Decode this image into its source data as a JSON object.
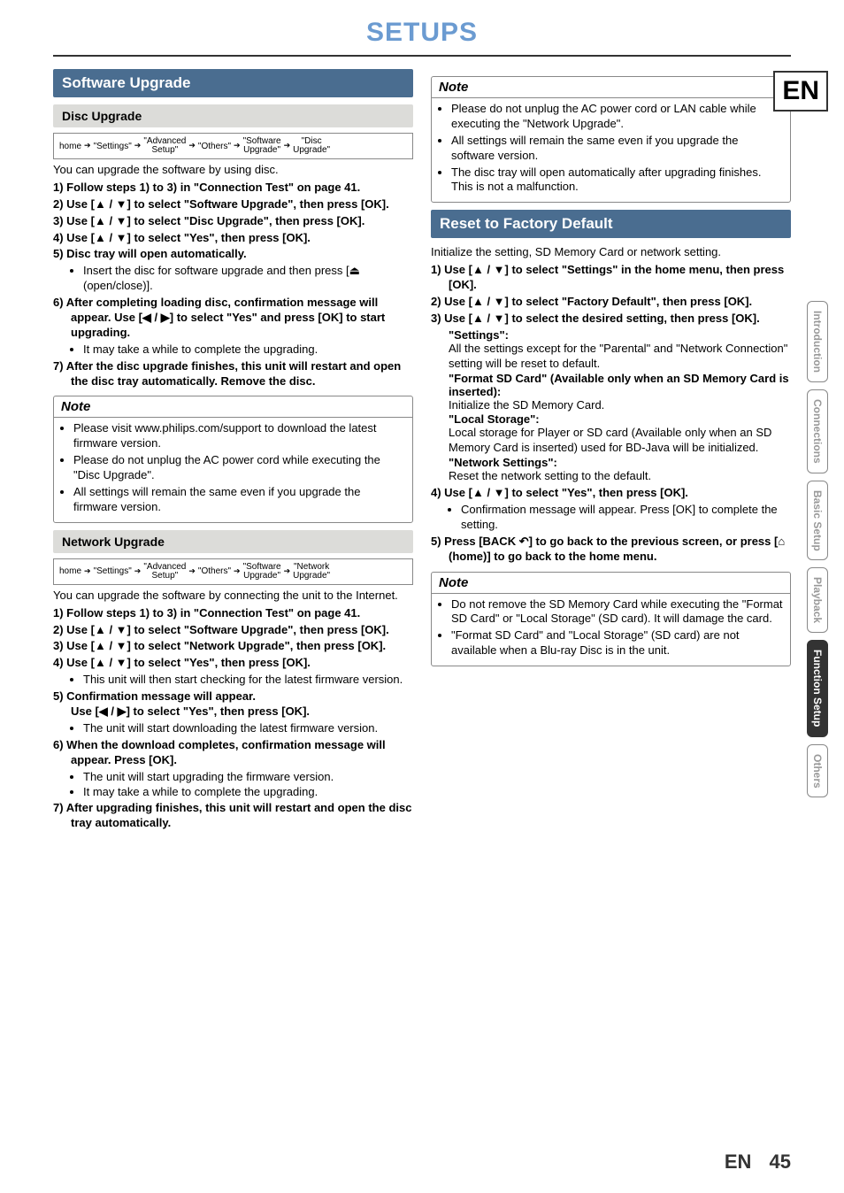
{
  "page_title": "SETUPS",
  "lang_badge": "EN",
  "footer": {
    "lang": "EN",
    "page": "45"
  },
  "tabs": {
    "t1": "Introduction",
    "t2": "Connections",
    "t3": "Basic Setup",
    "t4": "Playback",
    "t5": "Function Setup",
    "t6": "Others"
  },
  "left": {
    "section_title": "Software Upgrade",
    "disc": {
      "title": "Disc Upgrade",
      "crumb": {
        "c1": "home",
        "c2": "\"Settings\"",
        "c3a": "\"Advanced",
        "c3b": "Setup\"",
        "c4": "\"Others\"",
        "c5a": "\"Software",
        "c5b": "Upgrade\"",
        "c6a": "\"Disc",
        "c6b": "Upgrade\""
      },
      "intro": "You can upgrade the software by using disc.",
      "steps": {
        "s1": "1)  Follow steps 1) to 3) in \"Connection Test\" on page 41.",
        "s2": "2)  Use [▲ / ▼] to select \"Software Upgrade\", then press [OK].",
        "s3": "3)  Use [▲ / ▼] to select \"Disc Upgrade\", then press [OK].",
        "s4": "4)  Use [▲ / ▼] to select \"Yes\", then press [OK].",
        "s5": "5)  Disc tray will open automatically.",
        "s5b": "Insert the disc for software upgrade and then press [⏏ (open/close)].",
        "s6": "6)  After completing loading disc, confirmation message will appear. Use [◀ / ▶] to select \"Yes\" and press [OK] to start upgrading.",
        "s6b": "It may take a while to complete the upgrading.",
        "s7": "7)  After the disc upgrade finishes, this unit will restart and open the disc tray automatically. Remove the disc."
      },
      "note_title": "Note",
      "notes": {
        "n1": "Please visit www.philips.com/support to download the latest firmware version.",
        "n2": "Please do not unplug the AC power cord while executing the \"Disc Upgrade\".",
        "n3": "All settings will remain the same even if you upgrade the firmware version."
      }
    },
    "net": {
      "title": "Network Upgrade",
      "crumb": {
        "c1": "home",
        "c2": "\"Settings\"",
        "c3a": "\"Advanced",
        "c3b": "Setup\"",
        "c4": "\"Others\"",
        "c5a": "\"Software",
        "c5b": "Upgrade\"",
        "c6a": "\"Network",
        "c6b": "Upgrade\""
      },
      "intro": "You can upgrade the software by connecting the unit to the Internet.",
      "steps": {
        "s1": "1)  Follow steps 1) to 3) in \"Connection Test\" on page 41.",
        "s2": "2)  Use [▲ / ▼] to select \"Software Upgrade\", then press [OK].",
        "s3": "3)  Use [▲ / ▼] to select \"Network Upgrade\", then press [OK].",
        "s4": "4)  Use [▲ / ▼] to select \"Yes\", then press [OK].",
        "s4b": "This unit will then start checking for the latest firmware version.",
        "s5": "5)  Confirmation message will appear.",
        "s5a": "Use [◀ / ▶] to select \"Yes\", then press [OK].",
        "s5b": "The unit will start downloading the latest firmware version.",
        "s6": "6)  When the download completes, confirmation message will appear. Press [OK].",
        "s6b": "The unit will start upgrading the firmware version.",
        "s6c": "It may take a while to complete the upgrading.",
        "s7": "7)  After upgrading finishes, this unit will restart and open the disc tray automatically."
      }
    }
  },
  "right": {
    "note1": {
      "title": "Note",
      "n1": "Please do not unplug the AC power cord or LAN cable while executing the \"Network Upgrade\".",
      "n2": "All settings will remain the same even if you upgrade the software version.",
      "n3": "The disc tray will open automatically after upgrading finishes. This is not a malfunction."
    },
    "reset": {
      "title": "Reset to Factory Default",
      "intro": "Initialize the setting, SD Memory Card or network setting.",
      "steps": {
        "s1": "1)  Use [▲ / ▼] to select \"Settings\" in the home menu, then press [OK].",
        "s2": "2)  Use [▲ / ▼] to select \"Factory Default\", then press [OK].",
        "s3": "3)  Use [▲ / ▼] to select the desired setting, then press [OK].",
        "s3_h1": "\"Settings\":",
        "s3_t1": "All the settings except for the \"Parental\" and \"Network Connection\" setting will be reset to default.",
        "s3_h2": "\"Format SD Card\" (Available only when an SD Memory Card is inserted):",
        "s3_t2": "Initialize the SD Memory Card.",
        "s3_h3": "\"Local Storage\":",
        "s3_t3": "Local storage for Player or SD card (Available only when an SD Memory Card is inserted) used for BD-Java will be initialized.",
        "s3_h4": "\"Network Settings\":",
        "s3_t4": "Reset the network setting to the default.",
        "s4": "4)  Use [▲ / ▼] to select \"Yes\", then press [OK].",
        "s4b": "Confirmation message will appear. Press [OK] to complete the setting.",
        "s5": "5)  Press [BACK ↶] to go back to the previous screen, or press [⌂ (home)] to go back to the home menu."
      }
    },
    "note2": {
      "title": "Note",
      "n1": "Do not remove the SD Memory Card while executing the \"Format SD Card\" or \"Local Storage\" (SD card). It will damage the card.",
      "n2": "\"Format SD Card\" and \"Local Storage\" (SD card) are not available when a Blu-ray Disc is in the unit."
    }
  }
}
